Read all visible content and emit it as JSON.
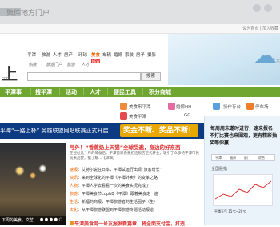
{
  "browser": {
    "title_fragment": "聚件地方门户"
  },
  "top_nav": {
    "right_text": "设为首页 | 加入收藏"
  },
  "category_nav": [
    "平潭",
    "旅游",
    "人才",
    "房产",
    "环球",
    "美食",
    "车辆",
    "婚嫁",
    "家装",
    "房子",
    "摄影"
  ],
  "category_nav_highlight": "美食",
  "logo": {
    "main": "上",
    "sub": "com"
  },
  "quick_tags": [
    "热搜",
    "旅游门户",
    "旅游",
    "人才"
  ],
  "new_badge": "NEW",
  "search": {
    "placeholder": "",
    "button": "搜索"
  },
  "main_nav": [
    "平潭事",
    "搜平潭",
    "活动",
    "人才",
    "便民工具",
    "积分商城"
  ],
  "sub_nav": [
    {
      "label": "美食来平潭",
      "color": "#f08a3c"
    },
    {
      "label": "美食平潭",
      "color": "#e5484d"
    },
    {
      "label": "婚嫁HH",
      "color": "#e46aa0"
    },
    {
      "label": "GG",
      "color": "#5aa0dd"
    },
    {
      "label": "操作存台",
      "color": "#ef7d2a"
    },
    {
      "label": "停车场",
      "color": "#7cb342"
    }
  ],
  "promo_banner": {
    "left_text": "平潭“一路上杯” 英雄联盟网吧联赛正式开启",
    "center_text": "奖金不断、奖品不断！"
  },
  "right_panel": {
    "line1": "每周周末邀时进行，速来报名",
    "line2": "不打比赛也来围观，更有精彩抽奖等你赢！",
    "tabs": [
      "平潭",
      "福州",
      "厦门",
      "综合"
    ],
    "stock_label": "全国股指",
    "weather": "平潭天气 15℃~20℃"
  },
  "photo": {
    "caption": "下周的美食，文艺",
    "pager": "● ● ● ● ○"
  },
  "news": {
    "headline": "号外！“香蕉奶上天猫”全球受邀，身边的好东西",
    "summary": "在经过几个月的筹备后，平潭首家香蕉奶连锁店正式开业，吸引了众多的平潭市民前来品尝，据了解…【详细】",
    "items": [
      {
        "tag": "速报",
        "text": "艾特尔说在日本，平潭试运行出现“旅客增长”"
      },
      {
        "tag": "快讯",
        "text": "来到全球化的平潭《平潭外卖》的变革之路"
      },
      {
        "tag": "人物",
        "text": "平潭人学去看看一次的美食实况完成了"
      },
      {
        "tag": "旅游",
        "text": "平潭美食节cupbB《平潭》跟着美食走一遍"
      },
      {
        "tag": "生活",
        "text": "新福的商报，平潭旅游者的生活圈子（生）"
      },
      {
        "tag": "文化",
        "text": "从平潭旅游联盟到平潭旅游专题活动报道"
      }
    ],
    "bottom_headline": "平潭美食网一号友报发新篇章，将全面支付宝，打造…"
  }
}
